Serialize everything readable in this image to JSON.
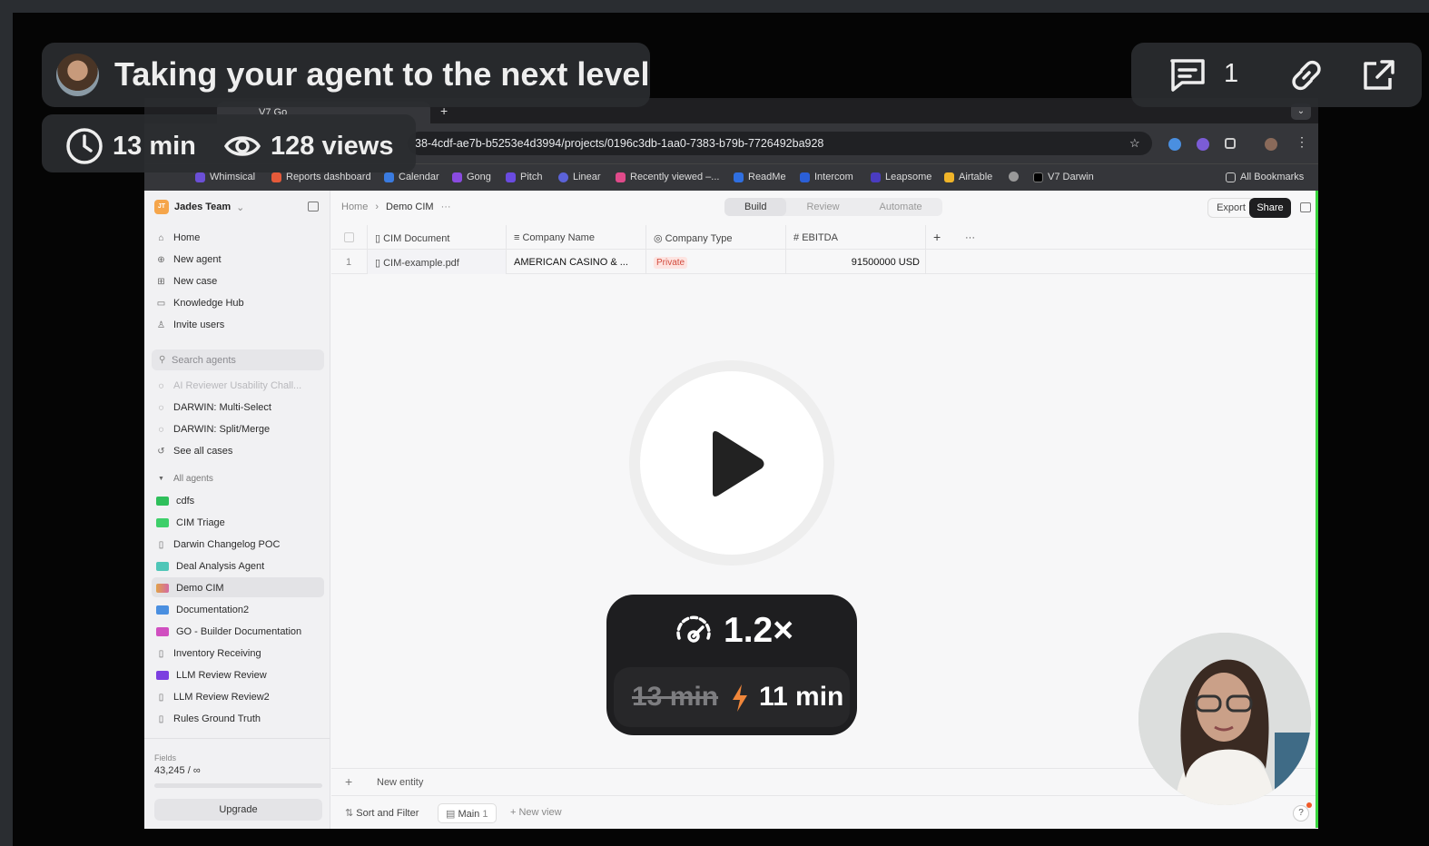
{
  "overlay": {
    "title": "Taking your agent to the next level",
    "duration": "13 min",
    "views": "128 views",
    "comment_count": "1",
    "icons": [
      "avatar",
      "clock-icon",
      "eye-icon",
      "comment-icon",
      "link-icon",
      "external-link-icon",
      "play-icon",
      "speed-icon",
      "bolt-icon"
    ]
  },
  "speed_popup": {
    "rate": "1.2×",
    "original_duration": "13 min",
    "sped_up_duration": "11 min"
  },
  "browser": {
    "tab_title": "V7 Go",
    "url": "38-4cdf-ae7b-b5253e4d3994/projects/0196c3db-1aa0-7383-b79b-7726492ba928",
    "bookmarks": [
      "Whimsical",
      "Reports dashboard",
      "Calendar",
      "Gong",
      "Pitch",
      "Linear",
      "Recently viewed –...",
      "ReadMe",
      "Intercom",
      "Leapsome",
      "Airtable",
      "V7 Darwin"
    ],
    "all_bookmarks": "All Bookmarks"
  },
  "sidebar": {
    "team": "Jades Team",
    "team_initials": "JT",
    "nav": [
      "Home",
      "New agent",
      "New case",
      "Knowledge Hub",
      "Invite users"
    ],
    "search_placeholder": "Search agents",
    "cases": [
      "AI Reviewer Usability Chall...",
      "DARWIN: Multi-Select",
      "DARWIN: Split/Merge",
      "See all cases"
    ],
    "agents_header": "All agents",
    "agents": [
      "cdfs",
      "CIM Triage",
      "Darwin Changelog POC",
      "Deal Analysis Agent",
      "Demo CIM",
      "Documentation2",
      "GO - Builder Documentation",
      "Inventory Receiving",
      "LLM Review Review",
      "LLM Review Review2",
      "Rules Ground Truth"
    ],
    "fields_label": "Fields",
    "fields_value": "43,245 / ∞",
    "upgrade": "Upgrade"
  },
  "main": {
    "breadcrumb": [
      "Home",
      "Demo CIM"
    ],
    "modes": [
      "Build",
      "Review",
      "Automate"
    ],
    "export": "Export",
    "share": "Share",
    "columns": [
      "CIM Document",
      "Company Name",
      "Company Type",
      "EBITDA"
    ],
    "row": {
      "index": "1",
      "document": "CIM-example.pdf",
      "company_name": "AMERICAN CASINO & ...",
      "company_type": "Private",
      "ebitda": "91500000 USD"
    },
    "new_entity": "New entity",
    "sort_filter": "Sort and Filter",
    "view_main": "Main",
    "view_main_count": "1",
    "new_view": "New view"
  }
}
